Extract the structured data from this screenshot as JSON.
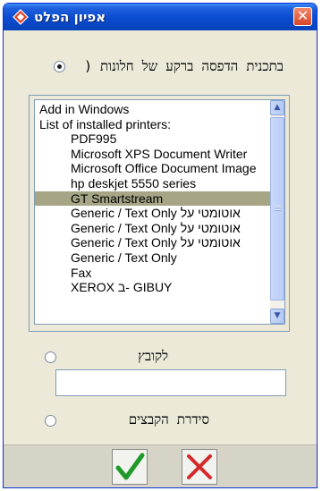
{
  "window": {
    "title": "אפיון הפלט"
  },
  "options": {
    "background_print": {
      "label": "בתכנית הדפסה ברקע של חלונות (",
      "selected": true
    },
    "to_file": {
      "label": "לקובץ",
      "selected": false
    },
    "file_series": {
      "label": "סידרת הקבצים",
      "selected": false
    }
  },
  "printer_list": {
    "items": [
      {
        "label": "Add in Windows",
        "indent": false
      },
      {
        "label": "List of installed printers:",
        "indent": false
      },
      {
        "label": "PDF995",
        "indent": true
      },
      {
        "label": "Microsoft XPS Document Writer",
        "indent": true
      },
      {
        "label": "Microsoft Office Document Image",
        "indent": true
      },
      {
        "label": "hp deskjet 5550 series",
        "indent": true
      },
      {
        "label": "GT Smartstream",
        "indent": true,
        "selected": true
      },
      {
        "label": "Generic / Text Only אוטומטי על",
        "indent": true
      },
      {
        "label": "Generic / Text Only אוטומטי על",
        "indent": true
      },
      {
        "label": "Generic / Text Only אוטומטי על",
        "indent": true
      },
      {
        "label": "Generic / Text Only",
        "indent": true
      },
      {
        "label": "Fax",
        "indent": true
      },
      {
        "label": "XEROX ב- GIBUY",
        "indent": true
      }
    ]
  },
  "file_input": {
    "value": ""
  },
  "buttons": {
    "ok": "ok-check-icon",
    "cancel": "cancel-x-icon"
  },
  "colors": {
    "titlebar": "#0a4bd0",
    "selection": "#a6a687",
    "ok": "#1f9a2a",
    "cancel": "#d22a2a"
  }
}
